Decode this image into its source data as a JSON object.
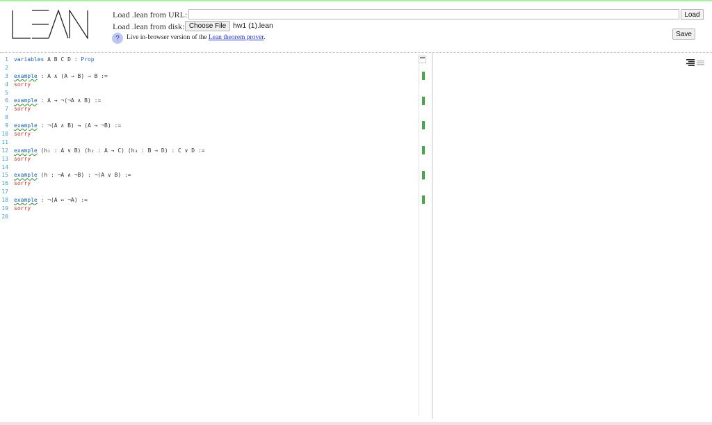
{
  "app": {
    "logo_text": "LEAN",
    "accent": "#4aa84a",
    "link_color": "#2233cc"
  },
  "header": {
    "url_label": "Load .lean from URL:",
    "url_value": "",
    "url_placeholder": "",
    "load_button": "Load",
    "disk_label": "Load .lean from disk:",
    "choose_file_button": "Choose File",
    "chosen_file": "hw1 (1).lean",
    "save_button": "Save",
    "help_icon": "?",
    "tagline_prefix": "Live in-browser version of the ",
    "tagline_link": "Lean theorem prover",
    "tagline_suffix": "."
  },
  "editor": {
    "lines": [
      {
        "n": "1",
        "kw": "variables",
        "text": " A B C D : ",
        "type": "Prop"
      },
      {
        "n": "2",
        "text": ""
      },
      {
        "n": "3",
        "ex": "example",
        "text": " : A ∧ (A → B) → B :="
      },
      {
        "n": "4",
        "sorry": "sorry"
      },
      {
        "n": "5",
        "text": ""
      },
      {
        "n": "6",
        "ex": "example",
        "text": " : A → ¬(¬A ∧ B) :="
      },
      {
        "n": "7",
        "sorry": "sorry"
      },
      {
        "n": "8",
        "text": ""
      },
      {
        "n": "9",
        "ex": "example",
        "text": " : ¬(A ∧ B) → (A → ¬B) :="
      },
      {
        "n": "10",
        "sorry": "sorry"
      },
      {
        "n": "11",
        "text": ""
      },
      {
        "n": "12",
        "ex": "example",
        "text": " (h₁ : A ∨ B) (h₂ : A → C) (h₃ : B → D) : C ∨ D :="
      },
      {
        "n": "13",
        "sorry": "sorry"
      },
      {
        "n": "14",
        "text": ""
      },
      {
        "n": "15",
        "ex": "example",
        "text": " (h : ¬A ∧ ¬B) : ¬(A ∨ B) :="
      },
      {
        "n": "16",
        "sorry": "sorry"
      },
      {
        "n": "17",
        "text": ""
      },
      {
        "n": "18",
        "ex": "example",
        "text": " : ¬(A ↔ ¬A) :="
      },
      {
        "n": "19",
        "sorry": "sorry"
      },
      {
        "n": "20",
        "text": ""
      }
    ],
    "marks_at_lines": [
      3,
      6,
      9,
      12,
      15,
      18
    ]
  },
  "right_panel": {
    "icon": "menu-lines-icon"
  }
}
